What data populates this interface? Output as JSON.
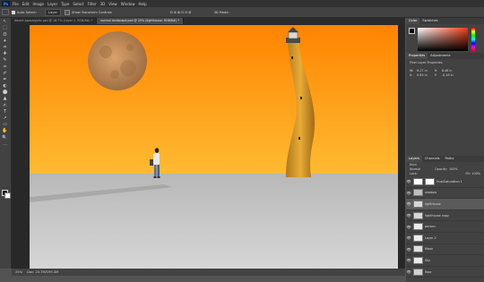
{
  "menu": [
    "File",
    "Edit",
    "Image",
    "Layer",
    "Type",
    "Select",
    "Filter",
    "3D",
    "View",
    "Window",
    "Help"
  ],
  "options": {
    "auto_select_label": "Auto-Select:",
    "auto_select_value": "Layer",
    "transform_label": "Show Transform Controls",
    "mode_label": "3D Mode:"
  },
  "tabs": [
    {
      "label": "desert-apocalyptic.psd @ 16.7% (Layer 2, RGB/8#) *",
      "active": false
    },
    {
      "label": "surreal landscape.psd @ 25% (lighthouse, RGB/8#) *",
      "active": true
    }
  ],
  "tools": [
    "↖",
    "⬚",
    "ʘ",
    "✦",
    "⌗",
    "✚",
    "✎",
    "♒",
    "✐",
    "✒",
    "◐",
    "⬤",
    "▲",
    "✍",
    "T",
    "↗",
    "▭",
    "✋",
    "🔍",
    "…"
  ],
  "status": {
    "zoom": "25%",
    "doc": "Doc: 20.7M/199.3M"
  },
  "panels": {
    "color": {
      "tabs": [
        "Color",
        "Swatches"
      ]
    },
    "properties": {
      "tabs": [
        "Properties",
        "Adjustments"
      ],
      "subtitle": "Pixel Layer Properties",
      "w_label": "W:",
      "w_value": "6.27 in",
      "h_label": "H:",
      "h_value": "8.48 in",
      "x_label": "X:",
      "x_value": "9.83 in",
      "y_label": "Y:",
      "y_value": "-0.16 in"
    },
    "layers": {
      "tabs": [
        "Layers",
        "Channels",
        "Paths"
      ],
      "kind": "Kind",
      "blend": "Normal",
      "opacity_label": "Opacity:",
      "opacity_value": "100%",
      "fill_label": "Fill:",
      "fill_value": "100%",
      "lock_label": "Lock:",
      "items": [
        {
          "name": "Hue/Saturation 1",
          "mask": true,
          "selected": false
        },
        {
          "name": "shadow",
          "mask": false,
          "selected": false
        },
        {
          "name": "lighthouse",
          "mask": false,
          "selected": true
        },
        {
          "name": "lighthouse copy",
          "mask": false,
          "selected": false
        },
        {
          "name": "person",
          "mask": false,
          "selected": false
        },
        {
          "name": "Layer 2",
          "mask": false,
          "selected": false
        },
        {
          "name": "Moon",
          "mask": false,
          "selected": false
        },
        {
          "name": "Sky",
          "mask": false,
          "selected": false
        },
        {
          "name": "floor",
          "mask": false,
          "selected": false
        }
      ]
    }
  },
  "colors": {
    "sky_top": "#ff8400",
    "sky_bottom": "#ffbb33",
    "ground": "#c8c8c8",
    "moon": "#c08a55",
    "lighthouse": "#e2a231"
  }
}
